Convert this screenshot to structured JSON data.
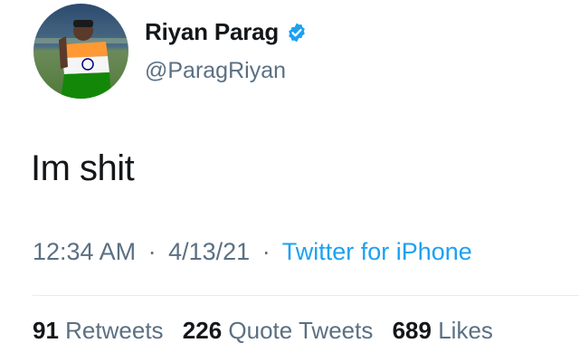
{
  "author": {
    "display_name": "Riyan Parag",
    "handle": "@ParagRiyan",
    "verified_icon": "verified-badge-icon",
    "avatar_icon": "profile-photo"
  },
  "tweet": {
    "text": "Im shit"
  },
  "meta": {
    "time": "12:34 AM",
    "date": "4/13/21",
    "separator": "·",
    "source": "Twitter for iPhone"
  },
  "stats": {
    "retweets_count": "91",
    "retweets_label": "Retweets",
    "quote_tweets_count": "226",
    "quote_tweets_label": "Quote Tweets",
    "likes_count": "689",
    "likes_label": "Likes"
  },
  "colors": {
    "link": "#1da1f2",
    "secondary_text": "#5b7083",
    "primary_text": "#14171a",
    "verified": "#1da1f2"
  }
}
